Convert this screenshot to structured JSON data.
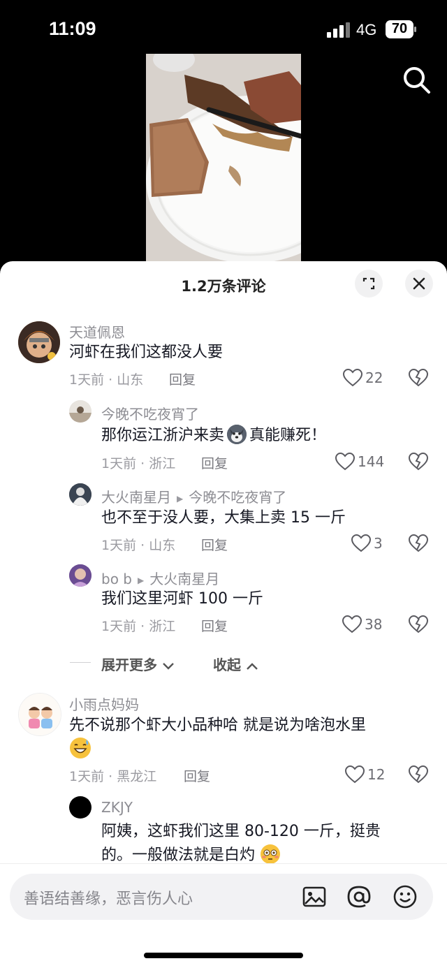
{
  "status": {
    "time": "11:09",
    "network": "4G",
    "battery": "70"
  },
  "sheet": {
    "title": "1.2万条评论"
  },
  "comments": [
    {
      "name": "天道佩恩",
      "text": "河虾在我们这都没人要",
      "meta": "1天前 · 山东",
      "reply": "回复",
      "likes": "22"
    },
    {
      "name": "今晚不吃夜宵了",
      "text_a": "那你运江浙沪来卖",
      "text_b": "真能赚死！",
      "meta": "1天前 · 浙江",
      "reply": "回复",
      "likes": "144"
    },
    {
      "name": "大火南星月",
      "reply_to": "今晚不吃夜宵了",
      "text": "也不至于没人要，大集上卖 15 一斤",
      "meta": "1天前 · 山东",
      "reply": "回复",
      "likes": "3"
    },
    {
      "name": "bo b",
      "reply_to": "大火南星月",
      "text": "我们这里河虾 100 一斤",
      "meta": "1天前 · 浙江",
      "reply": "回复",
      "likes": "38"
    },
    {
      "name": "小雨点妈妈",
      "text_line1": "先不说那个虾大小品种哈  就是说为啥泡水里",
      "meta": "1天前 · 黑龙江",
      "reply": "回复",
      "likes": "12"
    },
    {
      "name": "ZKJY",
      "text_line1": "阿姨，这虾我们这里 80-120 一斤，挺贵",
      "text_line2": "的。一般做法就是白灼"
    }
  ],
  "expand": {
    "more": "展开更多",
    "collapse": "收起"
  },
  "input": {
    "placeholder": "善语结善缘，恶言伤人心"
  },
  "colors": {
    "accent": "#161823",
    "muted": "#9a9aa0",
    "sheet_bg": "#ffffff"
  }
}
